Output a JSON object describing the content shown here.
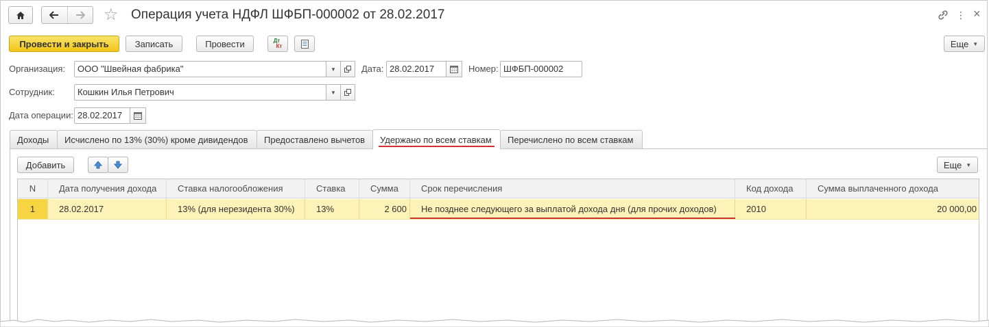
{
  "window": {
    "title": "Операция учета НДФЛ ШФБП-000002 от 28.02.2017",
    "more_glyph": "⋮",
    "close_glyph": "×"
  },
  "toolbar": {
    "post_close_label": "Провести и закрыть",
    "save_label": "Записать",
    "post_label": "Провести",
    "dt_label": "Дт",
    "kt_label": "Кт",
    "more_label": "Еще"
  },
  "form": {
    "org_label": "Организация:",
    "org_value": "ООО \"Швейная фабрика\"",
    "date_label": "Дата:",
    "date_value": "28.02.2017",
    "number_label": "Номер:",
    "number_value": "ШФБП-000002",
    "employee_label": "Сотрудник:",
    "employee_value": "Кошкин Илья Петрович",
    "op_date_label": "Дата операции:",
    "op_date_value": "28.02.2017"
  },
  "tabs": [
    {
      "label": "Доходы"
    },
    {
      "label": "Исчислено по 13% (30%) кроме дивидендов"
    },
    {
      "label": "Предоставлено вычетов"
    },
    {
      "label": "Удержано по всем ставкам"
    },
    {
      "label": "Перечислено по всем ставкам"
    }
  ],
  "table_toolbar": {
    "add_label": "Добавить",
    "more_label": "Еще"
  },
  "table": {
    "columns": [
      "N",
      "Дата получения дохода",
      "Ставка налогообложения",
      "Ставка",
      "Сумма",
      "Срок перечисления",
      "Код дохода",
      "Сумма выплаченного дохода"
    ],
    "rows": [
      [
        "1",
        "28.02.2017",
        "13% (для нерезидента 30%)",
        "13%",
        "2 600",
        "Не позднее следующего за выплатой дохода дня (для прочих доходов)",
        "2010",
        "20 000,00"
      ]
    ]
  },
  "colors": {
    "primary_button": "#f2c518",
    "selected_row": "#fdf3b8",
    "highlight_underline": "#d32f2f"
  }
}
